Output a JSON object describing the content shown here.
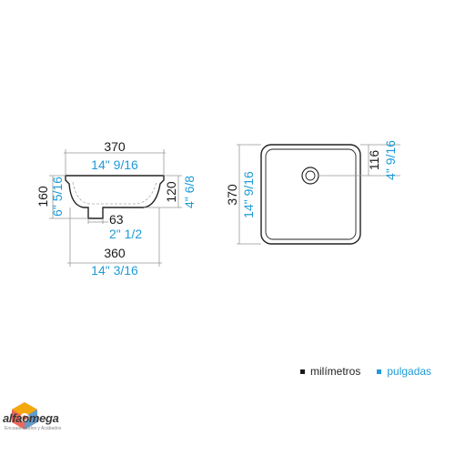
{
  "side_view": {
    "top_width_mm": "370",
    "top_width_in": "14\" 9/16",
    "bottom_width_mm": "360",
    "bottom_width_in": "14\" 3/16",
    "height_mm": "160",
    "height_in": "6\" 5/16",
    "inner_depth_mm": "120",
    "inner_depth_in": "4\" 6/8",
    "drain_mm": "63",
    "drain_in": "2\" 1/2"
  },
  "top_view": {
    "depth_mm": "370",
    "depth_in": "14\" 9/16",
    "drain_offset_mm": "116",
    "drain_offset_in": "4\" 9/16"
  },
  "legend": {
    "mm_label": "milímetros",
    "in_label": "pulgadas"
  },
  "colors": {
    "mm": "#1a1a1a",
    "in": "#1e9bd7",
    "line": "#222222",
    "dim_line": "#999999"
  },
  "logo": {
    "name": "alfaomega",
    "tagline": "Encuadernados y Acabados"
  }
}
